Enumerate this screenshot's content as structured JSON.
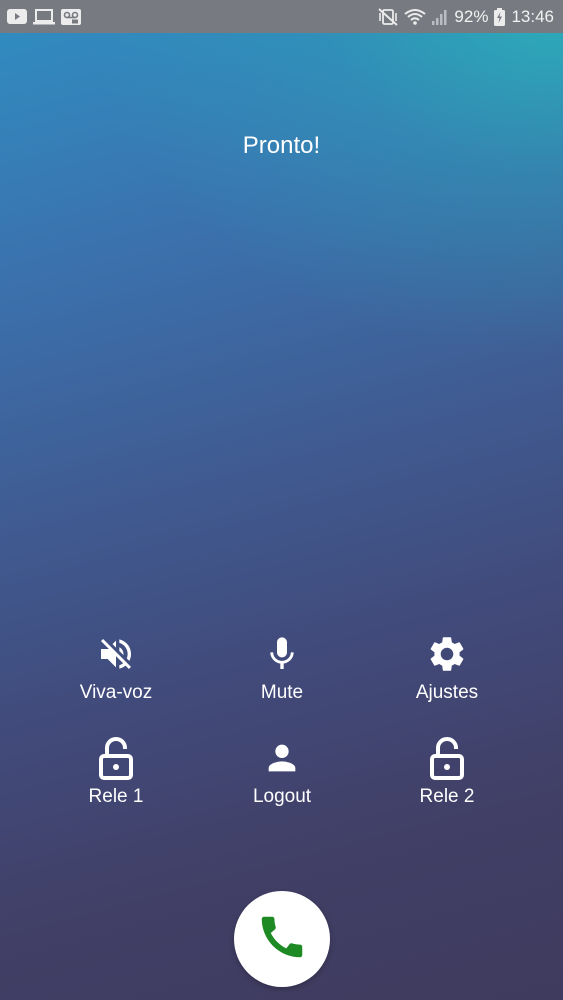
{
  "status_bar": {
    "left_icons": [
      "youtube-icon",
      "laptop-icon",
      "voicemail-icon"
    ],
    "right_icons": [
      "vibrate-mute-icon",
      "wifi-icon",
      "signal-icon",
      "battery-charging-icon"
    ],
    "battery": "92%",
    "time": "13:46"
  },
  "status_text": "Pronto!",
  "controls": [
    {
      "label": "Viva-voz",
      "icon": "speaker-off-icon"
    },
    {
      "label": "Mute",
      "icon": "microphone-icon"
    },
    {
      "label": "Ajustes",
      "icon": "gear-icon"
    },
    {
      "label": "Rele 1",
      "icon": "unlock-icon"
    },
    {
      "label": "Logout",
      "icon": "person-icon"
    },
    {
      "label": "Rele 2",
      "icon": "unlock-icon"
    }
  ],
  "call_button": {
    "icon": "phone-icon",
    "color": "#1e8a24"
  }
}
